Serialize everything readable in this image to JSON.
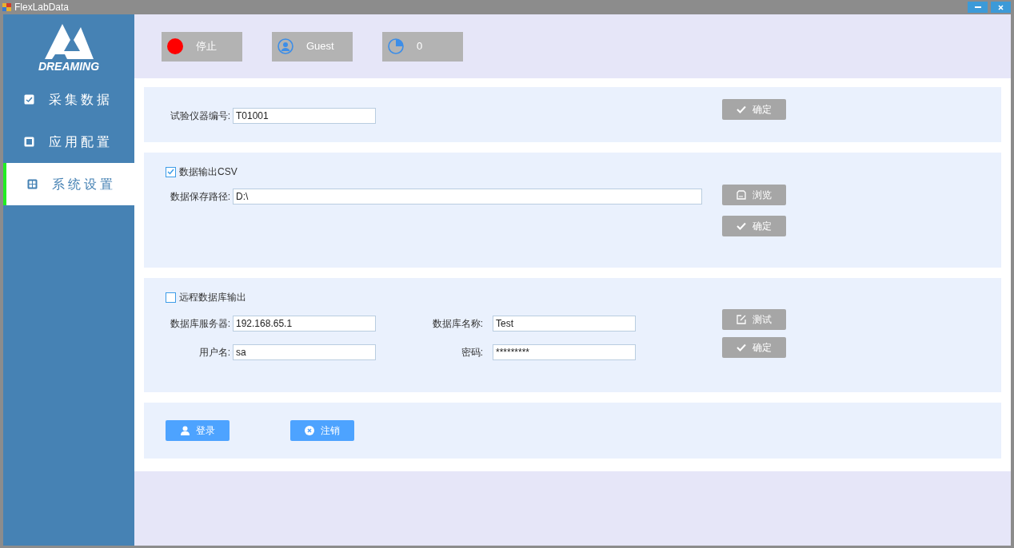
{
  "window": {
    "title": "FlexLabData"
  },
  "sidebar": {
    "logo_text": "DREAMING",
    "items": [
      {
        "label": "采集数据",
        "kind": "collect",
        "selected": false
      },
      {
        "label": "应用配置",
        "kind": "config",
        "selected": false
      },
      {
        "label": "系统设置",
        "kind": "settings",
        "selected": true
      }
    ]
  },
  "status": [
    {
      "kind": "state",
      "text": "停止"
    },
    {
      "kind": "user",
      "text": "Guest"
    },
    {
      "kind": "count",
      "text": "0"
    }
  ],
  "instrument": {
    "label": "试验仪器编号:",
    "value": "T01001",
    "confirm": {
      "label": "确定",
      "disabled": true
    }
  },
  "csv": {
    "checkbox": {
      "label": "数据输出CSV",
      "checked": true
    },
    "path_label": "数据保存路径:",
    "path": "D:\\",
    "browse": {
      "label": "浏览",
      "disabled": true
    },
    "confirm": {
      "label": "确定",
      "disabled": true
    }
  },
  "database": {
    "checkbox": {
      "label": "远程数据库输出",
      "checked": false
    },
    "fields": [
      {
        "label": "数据库服务器:",
        "value": "192.168.65.1"
      },
      {
        "label": "数据库名称:",
        "value": "Test"
      },
      {
        "label": "用户名:",
        "value": "sa"
      },
      {
        "label": "密码:",
        "value": "*********"
      }
    ],
    "test": {
      "label": "测试",
      "disabled": true
    },
    "confirm": {
      "label": "确定",
      "disabled": true
    }
  },
  "actions": [
    {
      "kind": "login",
      "label": "登录",
      "disabled": false
    },
    {
      "kind": "logout",
      "label": "注销",
      "disabled": false
    }
  ]
}
